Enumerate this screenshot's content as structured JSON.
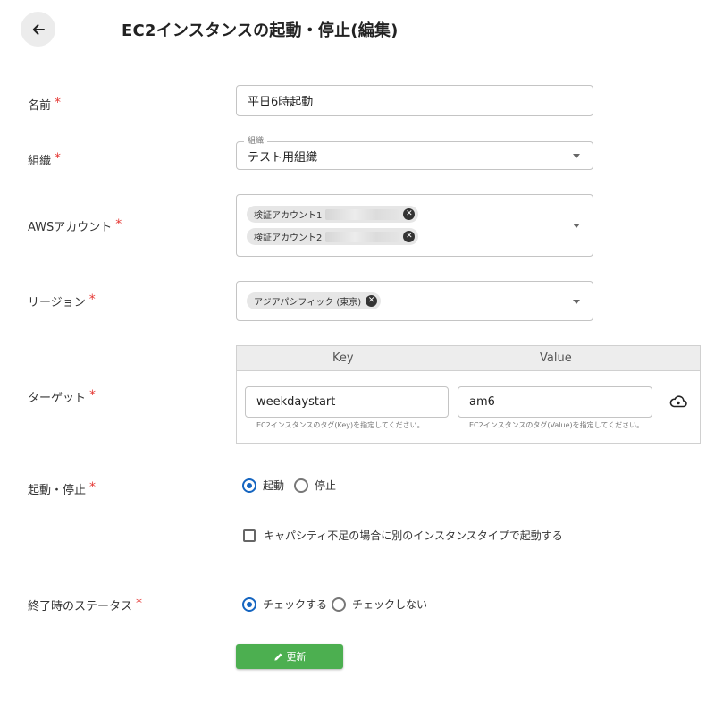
{
  "header": {
    "back_icon": "arrow-left-icon",
    "title": "EC2インスタンスの起動・停止(編集)"
  },
  "colors": {
    "required": "#e53935",
    "radio_selected": "#1565c0",
    "submit_bg": "#4caf50"
  },
  "form": {
    "required_mark": "*",
    "name": {
      "label": "名前",
      "value": "平日6時起動"
    },
    "org": {
      "label": "組織",
      "legend": "組織",
      "value": "テスト用組織"
    },
    "aws_account": {
      "label": "AWSアカウント",
      "chips": [
        {
          "text": "検証アカウント1"
        },
        {
          "text": "検証アカウント2"
        }
      ]
    },
    "region": {
      "label": "リージョン",
      "chips": [
        {
          "text": "アジアパシフィック (東京)"
        }
      ]
    },
    "target": {
      "label": "ターゲット",
      "key_header": "Key",
      "value_header": "Value",
      "key_value": "weekdaystart",
      "value_value": "am6",
      "key_help": "EC2インスタンスのタグ(Key)を指定してください。",
      "value_help": "EC2インスタンスのタグ(Value)を指定してください。",
      "icon": "tag-cloud-icon"
    },
    "action": {
      "label": "起動・停止",
      "options": [
        {
          "label": "起動",
          "selected": true
        },
        {
          "label": "停止",
          "selected": false
        }
      ],
      "capacity_checkbox": {
        "label": "キャパシティ不足の場合に別のインスタンスタイプで起動する",
        "checked": false
      }
    },
    "status": {
      "label": "終了時のステータス",
      "options": [
        {
          "label": "チェックする",
          "selected": true
        },
        {
          "label": "チェックしない",
          "selected": false
        }
      ]
    },
    "submit": {
      "label": "更新",
      "icon": "pencil-icon"
    }
  }
}
